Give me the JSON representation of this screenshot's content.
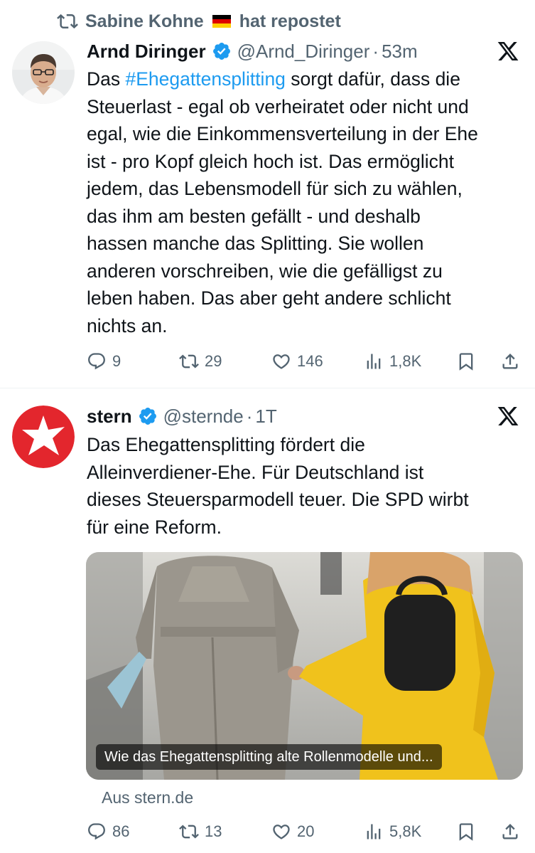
{
  "repost": {
    "text_before": "Sabine Kohne",
    "text_after": "hat repostet",
    "flag": "de-flag-emoji"
  },
  "tweets": [
    {
      "author_name": "Arnd Diringer",
      "handle": "@Arnd_Diringer",
      "time": "53m",
      "text_lines": [
        [
          "Das ",
          "#Ehegattensplitting",
          " sorgt dafür, dass die"
        ],
        "Steuerlast - egal ob verheiratet oder nicht und",
        "egal, wie die Einkommensverteilung in der Ehe",
        "ist - pro Kopf gleich hoch ist. Das ermöglicht",
        "jedem, das Lebensmodell für sich zu wählen,",
        "das ihm am besten gefällt - und deshalb",
        "hassen manche das Splitting. Sie wollen",
        "anderen vorschreiben, wie die gefälligst zu",
        "leben haben. Das aber geht andere schlicht",
        "nichts an."
      ],
      "hashtag": "#Ehegattensplitting",
      "line1_before": "Das ",
      "line1_after": " sorgt dafür, dass die",
      "replies": "9",
      "reposts": "29",
      "likes": "146",
      "views": "1,8K"
    },
    {
      "author_name": "stern",
      "handle": "@sternde",
      "time": "1T",
      "text_lines": [
        "Das Ehegattensplitting fördert die",
        "Alleinverdiener-Ehe. Für Deutschland ist",
        "dieses Steuersparmodell teuer. Die SPD wirbt",
        "für eine Reform."
      ],
      "card_caption": "Wie das Ehegattensplitting alte Rollenmodelle und...",
      "card_source": "Aus stern.de",
      "replies": "86",
      "reposts": "13",
      "likes": "20",
      "views": "5,8K"
    }
  ],
  "colors": {
    "link": "#1d9bf0",
    "muted": "#536471",
    "text": "#0f1419",
    "stern_red": "#e3262d",
    "raincoat_yellow": "#f0c21c"
  }
}
